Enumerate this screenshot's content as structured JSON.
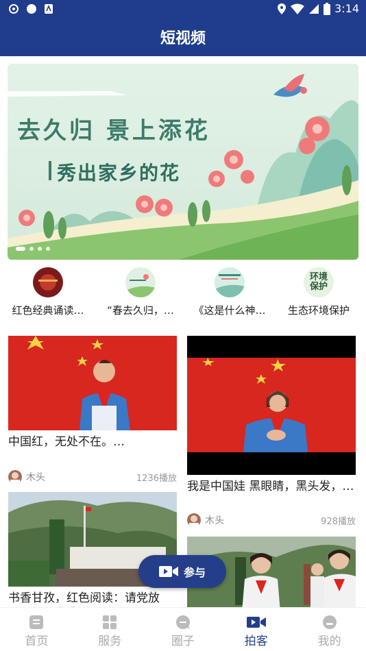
{
  "status_bar": {
    "time": "3:14"
  },
  "header": {
    "title": "短视频"
  },
  "banner": {
    "line1": "去久归  景上添花",
    "line2": "秀出家乡的花",
    "slide_count": 4,
    "active_slide": 1
  },
  "topics": [
    {
      "label": "红色经典诵读…"
    },
    {
      "label": "“春去久归，…"
    },
    {
      "label": "《这是什么神…"
    },
    {
      "label": "生态环境保护",
      "icon_text": "环境\n保护"
    }
  ],
  "videos": [
    {
      "title": "中国红，无处不在。…",
      "author": "木头",
      "plays": "1236播放"
    },
    {
      "title": "我是中国娃  黑眼睛，黑头发，…",
      "author": "木头",
      "plays": "928播放"
    },
    {
      "title": "书香甘孜，红色阅读：请党放心，强国有我！"
    },
    {
      "title": ""
    }
  ],
  "join_button": {
    "label": "参与"
  },
  "tabs": [
    {
      "label": "首页",
      "icon": "home-icon"
    },
    {
      "label": "服务",
      "icon": "grid-icon"
    },
    {
      "label": "圈子",
      "icon": "chat-icon"
    },
    {
      "label": "拍客",
      "icon": "camera-icon",
      "active": true
    },
    {
      "label": "我的",
      "icon": "profile-icon"
    }
  ],
  "colors": {
    "primary": "#1f3d8c",
    "active_tab": "#253e8a"
  }
}
